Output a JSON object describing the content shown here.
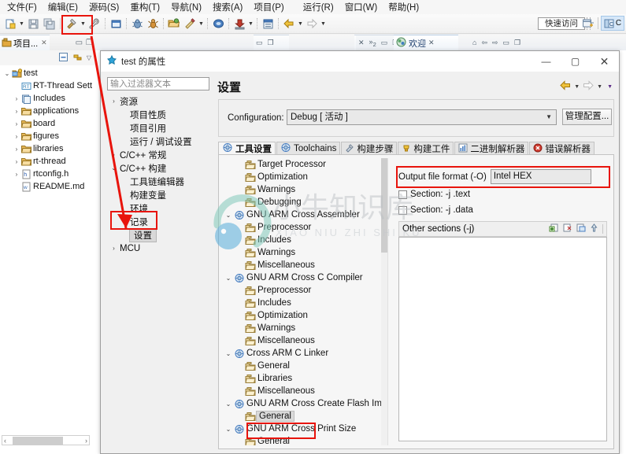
{
  "menubar": {
    "items": [
      "文件(F)",
      "编辑(E)",
      "源码(S)",
      "重构(T)",
      "导航(N)",
      "搜索(A)",
      "项目(P)",
      "运行(R)",
      "窗口(W)",
      "帮助(H)"
    ]
  },
  "toolbar": {
    "quick_access": "快速访问",
    "perspective_label": "C",
    "icons": [
      "new-file-icon",
      "new-file-dropdown",
      "save-icon",
      "save-all-icon",
      "build-hammer-icon",
      "build-dropdown",
      "build-config-wrench-icon",
      "console-icon",
      "debug-bug-icon",
      "run-ant-icon",
      "open-folder-icon",
      "skip-breakpoints-icon",
      "skip-dropdown",
      "search-icon",
      "download-flash-icon",
      "download-dropdown",
      "toggle-block-icon",
      "back-arrow-icon",
      "back-dropdown",
      "forward-arrow-icon",
      "forward-dropdown"
    ]
  },
  "project_explorer": {
    "tab_label": "项目...",
    "tree": [
      {
        "indent": 0,
        "twisty": "v",
        "icon": "project-icon",
        "label": "test"
      },
      {
        "indent": 1,
        "twisty": "",
        "icon": "rtthread-icon",
        "label": "RT-Thread Sett"
      },
      {
        "indent": 1,
        "twisty": ">",
        "icon": "includes-icon",
        "label": "Includes"
      },
      {
        "indent": 1,
        "twisty": ">",
        "icon": "folder-icon",
        "label": "applications"
      },
      {
        "indent": 1,
        "twisty": ">",
        "icon": "folder-icon",
        "label": "board"
      },
      {
        "indent": 1,
        "twisty": ">",
        "icon": "folder-icon",
        "label": "figures"
      },
      {
        "indent": 1,
        "twisty": ">",
        "icon": "folder-icon",
        "label": "libraries"
      },
      {
        "indent": 1,
        "twisty": ">",
        "icon": "folder-icon",
        "label": "rt-thread"
      },
      {
        "indent": 1,
        "twisty": ">",
        "icon": "header-file-icon",
        "label": "rtconfig.h"
      },
      {
        "indent": 1,
        "twisty": "",
        "icon": "markdown-file-icon",
        "label": "README.md"
      }
    ]
  },
  "editor_area": {
    "welcome_tab": "欢迎",
    "stacked_count": "2"
  },
  "dialog": {
    "title": "test 的属性",
    "filter_placeholder": "输入过滤器文本",
    "nav_tree": [
      {
        "indent": 0,
        "twisty": ">",
        "label": "资源",
        "selected": false
      },
      {
        "indent": 1,
        "twisty": "",
        "label": "项目性质",
        "selected": false
      },
      {
        "indent": 1,
        "twisty": "",
        "label": "项目引用",
        "selected": false
      },
      {
        "indent": 1,
        "twisty": "",
        "label": "运行 / 调试设置",
        "selected": false
      },
      {
        "indent": 0,
        "twisty": ">",
        "label": "C/C++ 常规",
        "selected": false
      },
      {
        "indent": 0,
        "twisty": "v",
        "label": "C/C++ 构建",
        "selected": false
      },
      {
        "indent": 1,
        "twisty": "",
        "label": "工具链编辑器",
        "selected": false
      },
      {
        "indent": 1,
        "twisty": "",
        "label": "构建变量",
        "selected": false
      },
      {
        "indent": 1,
        "twisty": "",
        "label": "环境",
        "selected": false
      },
      {
        "indent": 1,
        "twisty": "",
        "label": "记录",
        "selected": false
      },
      {
        "indent": 1,
        "twisty": "",
        "label": "设置",
        "selected": true
      },
      {
        "indent": 0,
        "twisty": ">",
        "label": "MCU",
        "selected": false
      }
    ],
    "page_title": "设置",
    "configuration": {
      "label": "Configuration:",
      "value": "Debug  [ 活动 ]",
      "manage_button": "管理配置..."
    },
    "tabs": [
      {
        "label": "工具设置",
        "icon": "tool-settings-icon",
        "active": true
      },
      {
        "label": "Toolchains",
        "icon": "toolchains-icon",
        "active": false
      },
      {
        "label": "构建步骤",
        "icon": "build-steps-icon",
        "active": false
      },
      {
        "label": "构建工件",
        "icon": "build-artifact-icon",
        "active": false
      },
      {
        "label": "二进制解析器",
        "icon": "binary-parser-icon",
        "active": false
      },
      {
        "label": "错误解析器",
        "icon": "error-parser-icon",
        "active": false
      }
    ],
    "tool_tree": [
      {
        "indent": 1,
        "twisty": "",
        "icon": "page-icon",
        "label": "Target Processor",
        "selected": false
      },
      {
        "indent": 1,
        "twisty": "",
        "icon": "page-icon",
        "label": "Optimization",
        "selected": false
      },
      {
        "indent": 1,
        "twisty": "",
        "icon": "page-icon",
        "label": "Warnings",
        "selected": false
      },
      {
        "indent": 1,
        "twisty": "",
        "icon": "page-icon",
        "label": "Debugging",
        "selected": false
      },
      {
        "indent": 0,
        "twisty": "v",
        "icon": "tool-icon",
        "label": "GNU ARM Cross Assembler",
        "selected": false
      },
      {
        "indent": 1,
        "twisty": "",
        "icon": "page-icon",
        "label": "Preprocessor",
        "selected": false
      },
      {
        "indent": 1,
        "twisty": "",
        "icon": "page-icon",
        "label": "Includes",
        "selected": false
      },
      {
        "indent": 1,
        "twisty": "",
        "icon": "page-icon",
        "label": "Warnings",
        "selected": false
      },
      {
        "indent": 1,
        "twisty": "",
        "icon": "page-icon",
        "label": "Miscellaneous",
        "selected": false
      },
      {
        "indent": 0,
        "twisty": "v",
        "icon": "tool-icon",
        "label": "GNU ARM Cross C Compiler",
        "selected": false
      },
      {
        "indent": 1,
        "twisty": "",
        "icon": "page-icon",
        "label": "Preprocessor",
        "selected": false
      },
      {
        "indent": 1,
        "twisty": "",
        "icon": "page-icon",
        "label": "Includes",
        "selected": false
      },
      {
        "indent": 1,
        "twisty": "",
        "icon": "page-icon",
        "label": "Optimization",
        "selected": false
      },
      {
        "indent": 1,
        "twisty": "",
        "icon": "page-icon",
        "label": "Warnings",
        "selected": false
      },
      {
        "indent": 1,
        "twisty": "",
        "icon": "page-icon",
        "label": "Miscellaneous",
        "selected": false
      },
      {
        "indent": 0,
        "twisty": "v",
        "icon": "tool-icon",
        "label": "Cross ARM C Linker",
        "selected": false
      },
      {
        "indent": 1,
        "twisty": "",
        "icon": "page-icon",
        "label": "General",
        "selected": false
      },
      {
        "indent": 1,
        "twisty": "",
        "icon": "page-icon",
        "label": "Libraries",
        "selected": false
      },
      {
        "indent": 1,
        "twisty": "",
        "icon": "page-icon",
        "label": "Miscellaneous",
        "selected": false
      },
      {
        "indent": 0,
        "twisty": "v",
        "icon": "tool-icon",
        "label": "GNU ARM Cross Create Flash Image",
        "selected": false
      },
      {
        "indent": 1,
        "twisty": "",
        "icon": "page-icon",
        "label": "General",
        "selected": true
      },
      {
        "indent": 0,
        "twisty": "v",
        "icon": "tool-icon",
        "label": "GNU ARM Cross Print Size",
        "selected": false
      },
      {
        "indent": 1,
        "twisty": "",
        "icon": "page-icon",
        "label": "General",
        "selected": false
      }
    ],
    "settings_panel": {
      "output_format_label": "Output file format (-O)",
      "output_format_value": "Intel HEX",
      "section_text_label": "Section: -j .text",
      "section_text_checked": false,
      "section_data_label": "Section: -j .data",
      "section_data_checked": false,
      "other_sections_label": "Other sections (-j)",
      "other_sections_tools": [
        "add-icon",
        "delete-icon",
        "edit-icon",
        "move-up-icon"
      ]
    }
  },
  "annotations": {
    "highlight_color": "#e8140c",
    "boxes": [
      "toolbar-build-config-wrench",
      "nav-settings-item",
      "output-format-row",
      "flash-image-general-item"
    ],
    "arrow": "pointer-from-toolbar-to-settings"
  },
  "watermark": {
    "primary": "小牛知识库",
    "secondary": "XIAO NIU ZHI SHI KU"
  }
}
